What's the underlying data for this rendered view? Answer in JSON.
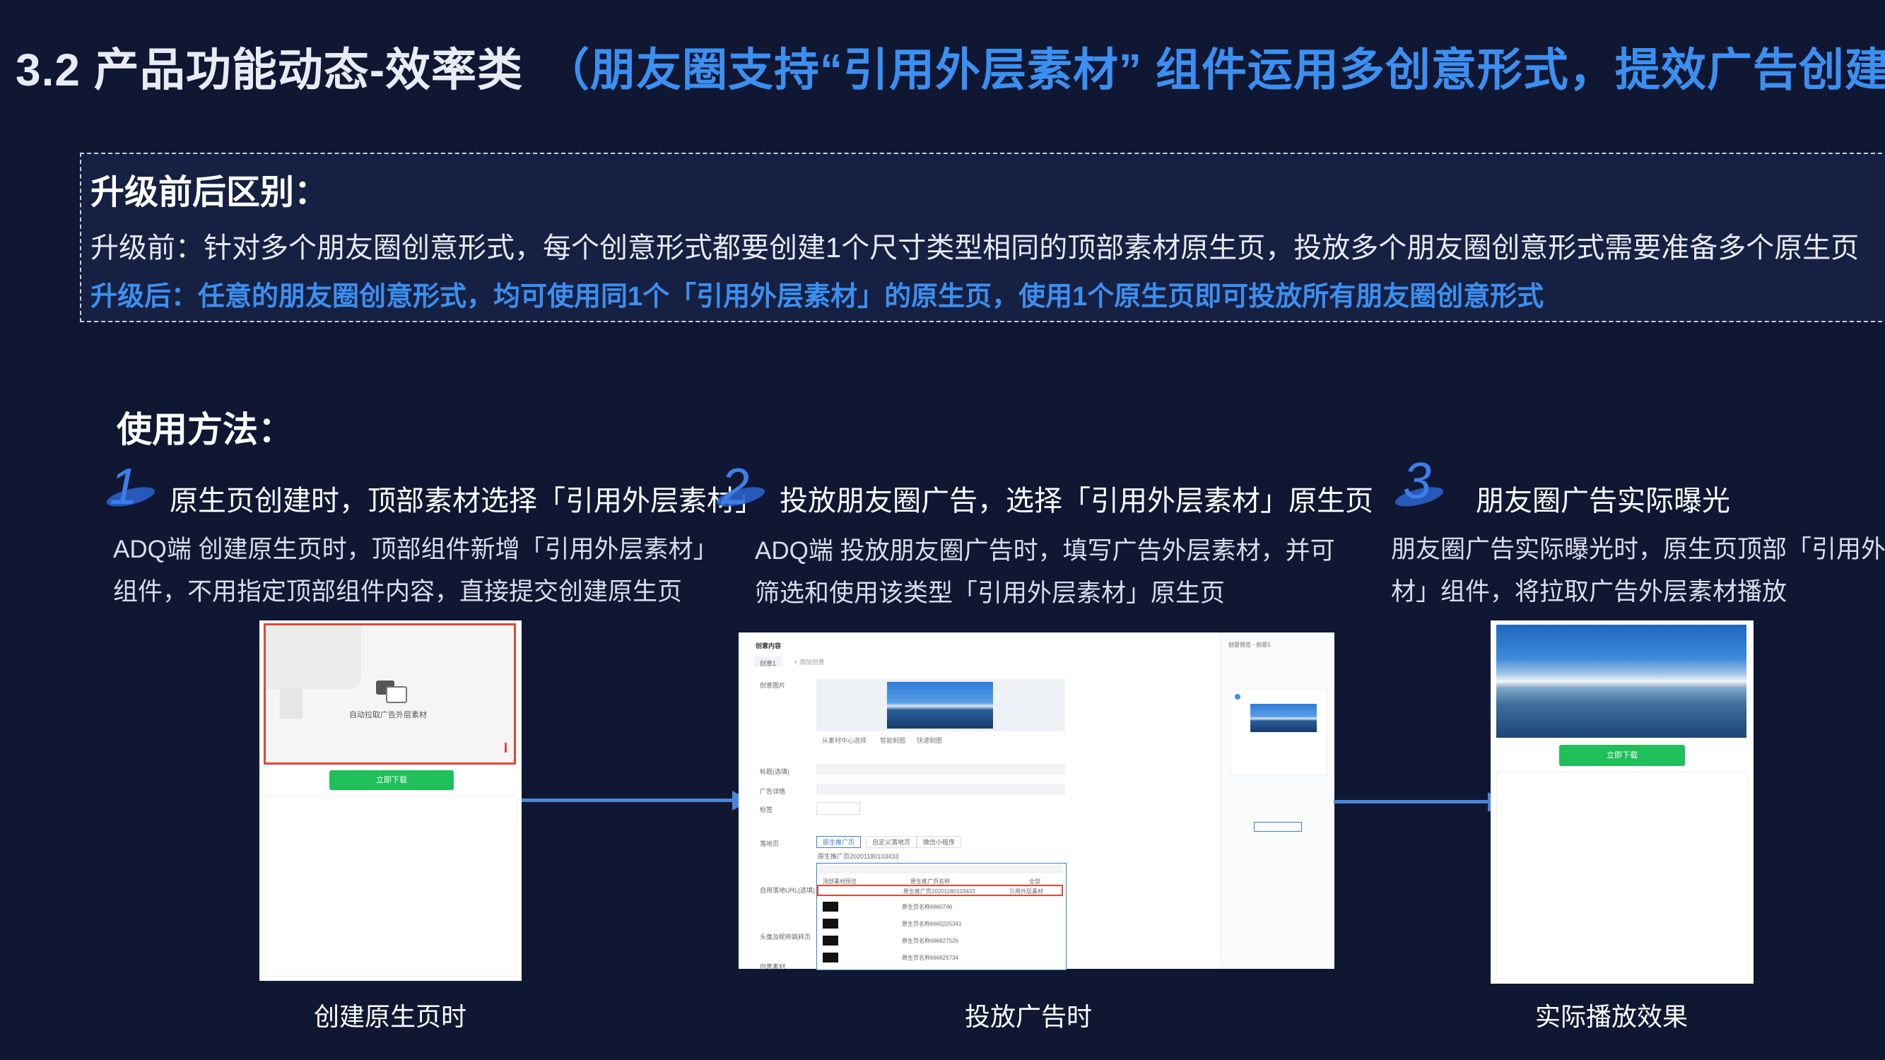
{
  "slide": {
    "title_main": "3.2 产品功能动态-效率类",
    "title_sub": "（朋友圈支持“引用外层素材” 组件运用多创意形式，提效广告创建）"
  },
  "compare": {
    "heading": "升级前后区别：",
    "before": "升级前：针对多个朋友圈创意形式，每个创意形式都要创建1个尺寸类型相同的顶部素材原生页，投放多个朋友圈创意形式需要准备多个原生页",
    "after": "升级后：任意的朋友圈创意形式，均可使用同1个「引用外层素材」的原生页，使用1个原生页即可投放所有朋友圈创意形式"
  },
  "usage": {
    "heading": "使用方法：",
    "steps": [
      {
        "num": "1",
        "title": "原生页创建时，顶部素材选择「引用外层素材」",
        "desc_line1": "ADQ端 创建原生页时，顶部组件新增「引用外层素材」",
        "desc_line2": "组件，不用指定顶部组件内容，直接提交创建原生页",
        "caption": "创建原生页时"
      },
      {
        "num": "2",
        "title": "投放朋友圈广告，选择「引用外层素材」原生页",
        "desc_line1": "ADQ端 投放朋友圈广告时，填写广告外层素材，并可",
        "desc_line2": "筛选和使用该类型「引用外层素材」原生页",
        "caption": "投放广告时"
      },
      {
        "num": "3",
        "title": "朋友圈广告实际曝光",
        "desc_line1": "朋友圈广告实际曝光时，原生页顶部「引用外层素",
        "desc_line2": "材」组件，将拉取广告外层素材播放",
        "caption": "实际播放效果"
      }
    ]
  },
  "panel1": {
    "placeholder_label": "自动拉取广告外层素材",
    "button_label": "立即下载"
  },
  "panel2": {
    "header": "创意内容",
    "tab1": "创意1",
    "tab2": "+ 添加创意",
    "right_header": "创意预览 - 创意1",
    "row_labels": [
      "创意图片",
      "标题(选填)",
      "广告详情",
      "标签",
      "落地页",
      "自用落地URL(选填)",
      "头像及昵称跳转页",
      "创意素材"
    ],
    "link_labels": [
      "从素材中心选择",
      "智能制图",
      "快速制图"
    ],
    "landing_tabs": [
      "原生推广页",
      "自定义落地页",
      "微信小程序"
    ],
    "list_header_1": "顶部素材预览",
    "list_header_2": "原生推广页名称",
    "list_header_3": "全部",
    "selected_name": "原生推广页20201180103433",
    "selected_tag": "引用外层素材",
    "items": [
      "原生页名称6660746",
      "原生页名称6660225341",
      "原生页名称666627526",
      "原生页名称666625734"
    ]
  },
  "panel3": {
    "button_label": "立即下载"
  },
  "colors": {
    "background": "#0f1733",
    "accent_blue": "#3b8ff0",
    "button_green": "#1fbf5a",
    "highlight_red": "#e8452f"
  }
}
